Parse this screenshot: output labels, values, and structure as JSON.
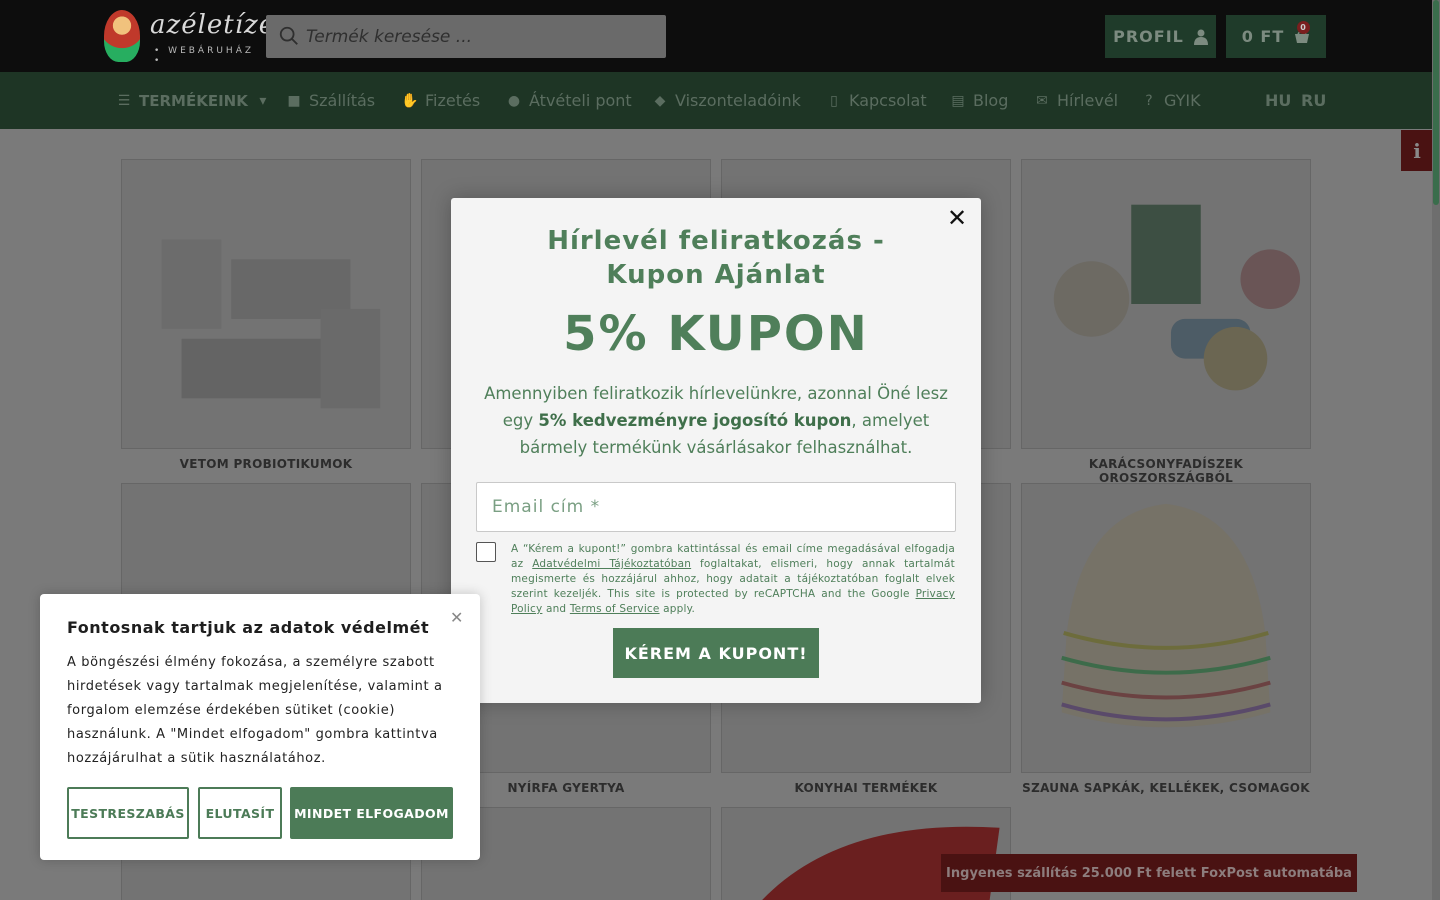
{
  "header": {
    "logo_text": "azéletíze",
    "logo_sub": "• WEBÁRUHÁZ •",
    "search_placeholder": "Termék keresése ...",
    "profile_label": "PROFIL",
    "cart_label": "0 FT",
    "cart_count": "0"
  },
  "nav": {
    "items": [
      {
        "label": "TERMÉKEINK",
        "icon": "menu-icon"
      },
      {
        "label": "Szállítás",
        "icon": "truck-icon"
      },
      {
        "label": "Fizetés",
        "icon": "hand-coin-icon"
      },
      {
        "label": "Átvételi pont",
        "icon": "map-pin-icon"
      },
      {
        "label": "Viszonteladóink",
        "icon": "handshake-icon"
      },
      {
        "label": "Kapcsolat",
        "icon": "mobile-icon"
      },
      {
        "label": "Blog",
        "icon": "book-icon"
      },
      {
        "label": "Hírlevél",
        "icon": "envelope-icon"
      },
      {
        "label": "GYIK",
        "icon": "question-icon"
      }
    ],
    "languages": [
      "HU",
      "RU"
    ]
  },
  "products": {
    "labels": [
      "VETOM PROBIOTIKUMOK",
      "KARÁCSONYFADÍSZEK OROSZORSZÁGBÓL",
      "NYÍRFA GYERTYA",
      "KONYHAI TERMÉKEK",
      "SZAUNA SAPKÁK, KELLÉKEK, CSOMAGOK"
    ]
  },
  "side_info_label": "i",
  "shipping_banner": "Ingyenes szállítás 25.000 Ft felett FoxPost automatába",
  "modal": {
    "title_line1": "Hírlevél feliratkozás -",
    "title_line2": "Kupon Ajánlat",
    "headline": "5% KUPON",
    "desc_part1": "Amennyiben feliratkozik hírlevelünkre, azonnal Öné lesz egy ",
    "desc_bold": "5% kedvezményre jogosító kupon",
    "desc_part2": ", amelyet bármely termékünk vásárlásakor felhasználhat.",
    "email_placeholder": "Email cím *",
    "consent_part1": "A “Kérem a kupont!” gombra kattintással és email címe megadásával elfogadja az ",
    "consent_link1": "Adatvédelmi Tájékoztatóban",
    "consent_part2": " foglaltakat, elismeri, hogy annak tartalmát megismerte és hozzájárul ahhoz, hogy adatait a tájékoztatóban foglalt elvek szerint kezeljék. This site is protected by reCAPTCHA and the Google ",
    "consent_link2": "Privacy Policy",
    "consent_and": " and ",
    "consent_link3": "Terms of Service",
    "consent_part3": " apply.",
    "submit_label": "KÉREM A KUPONT!",
    "close_label": "✕"
  },
  "cookie": {
    "title": "Fontosnak tartjuk az adatok védelmét",
    "text": "A böngészési élmény fokozása, a személyre szabott hirdetések vagy tartalmak megjelenítése, valamint a forgalom elemzése érdekében sütiket (cookie) használunk. A \"Mindet elfogadom\" gombra kattintva hozzájárulhat a sütik használatához.",
    "customize_label": "TESTRESZABÁS",
    "reject_label": "ELUTASÍT",
    "accept_label": "MINDET ELFOGADOM",
    "close_label": "✕"
  },
  "colors": {
    "brand_green": "#4c7b57",
    "header_dark": "#0d0d0d",
    "nav_green": "#1e3525",
    "alert_red": "#4a1212"
  }
}
